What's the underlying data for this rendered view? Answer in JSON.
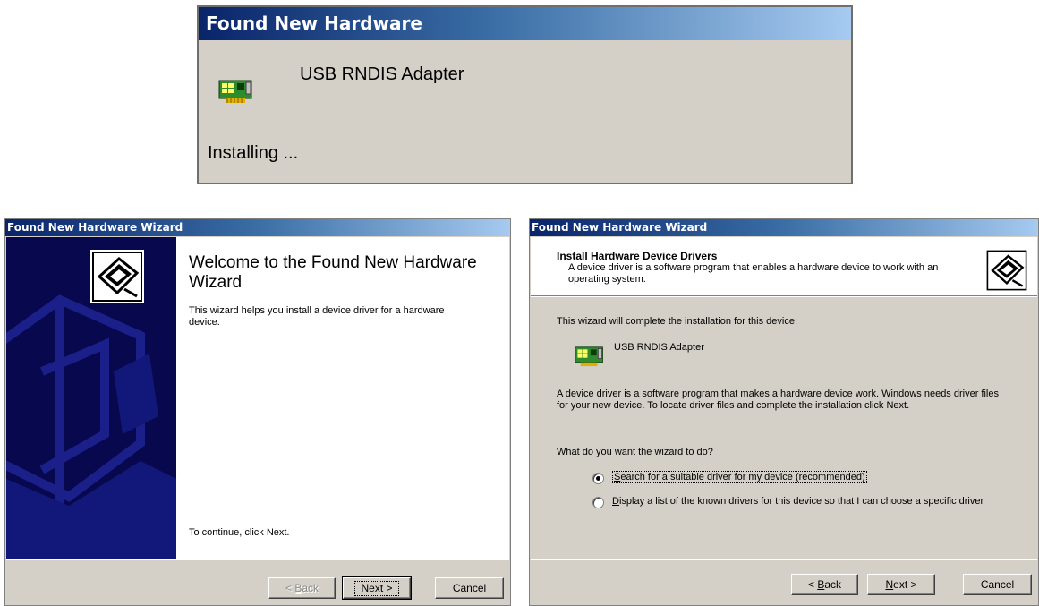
{
  "popup": {
    "title": "Found New Hardware",
    "device_name": "USB RNDIS Adapter",
    "status": "Installing ..."
  },
  "wizard_welcome": {
    "title": "Found New Hardware Wizard",
    "heading": "Welcome to the Found New Hardware Wizard",
    "description": "This wizard helps you install a device driver for a hardware device.",
    "continue_text": "To continue, click Next.",
    "buttons": {
      "back": {
        "pre": "< ",
        "key": "B",
        "rest": "ack",
        "enabled": false
      },
      "next": {
        "key": "N",
        "rest": "ext >"
      },
      "cancel": "Cancel"
    }
  },
  "wizard_install": {
    "title": "Found New Hardware Wizard",
    "header_title": "Install Hardware Device Drivers",
    "header_subtitle": "A device driver is a software program that enables a hardware device to work with an operating system.",
    "intro": "This wizard will complete the installation for this device:",
    "device_name": "USB RNDIS Adapter",
    "explanation": "A device driver is a software program that makes a hardware device work. Windows needs driver files for your new device. To locate driver files and complete the installation click Next.",
    "question": "What do you want the wizard to do?",
    "options": [
      {
        "key": "S",
        "rest": "earch for a suitable driver for my device (recommended)",
        "selected": true
      },
      {
        "key": "D",
        "rest": "isplay a list of the known drivers for this device so that I can choose a specific driver",
        "selected": false
      }
    ],
    "buttons": {
      "back": {
        "pre": "< ",
        "key": "B",
        "rest": "ack"
      },
      "next": {
        "key": "N",
        "rest": "ext >"
      },
      "cancel": "Cancel"
    }
  },
  "icons": {
    "device": "network-adapter-card-icon",
    "wizard": "hardware-wizard-icon"
  },
  "colors": {
    "title_bar_start": "#0a246a",
    "title_bar_end": "#a6caf0",
    "window_face": "#d4d0c8",
    "wizard_sidebar": "#08084e"
  }
}
